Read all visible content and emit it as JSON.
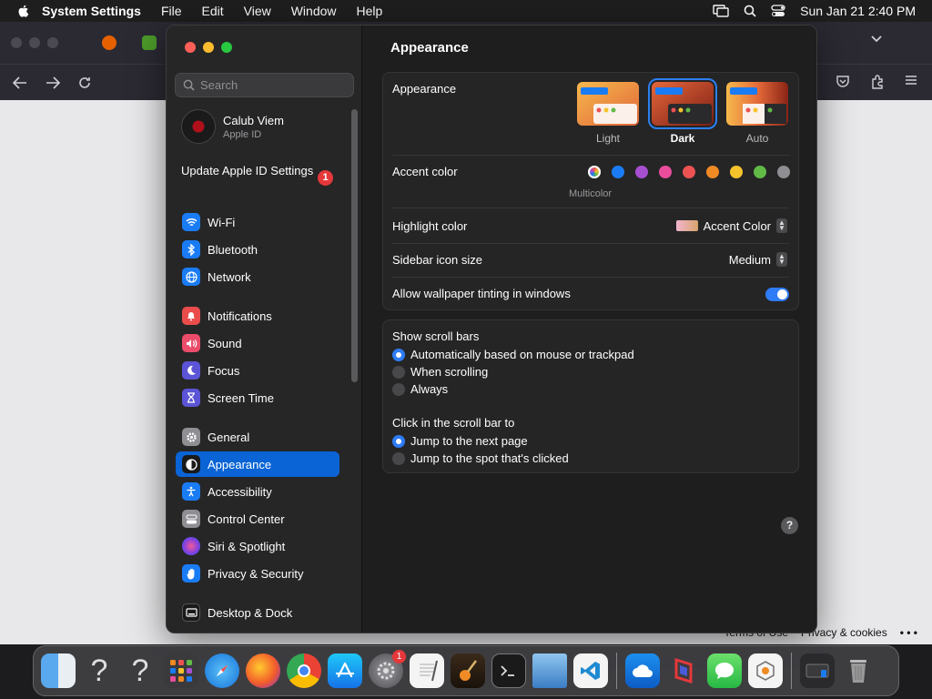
{
  "menubar": {
    "app_name": "System Settings",
    "items": [
      "File",
      "Edit",
      "View",
      "Window",
      "Help"
    ],
    "datetime": "Sun Jan 21  2:40 PM"
  },
  "browser": {
    "footer_left": "Terms of Use",
    "footer_right": "Privacy & cookies",
    "more": "• • •"
  },
  "sidebar": {
    "search_placeholder": "Search",
    "profile": {
      "name": "Calub Viem",
      "subtitle": "Apple ID"
    },
    "update": {
      "label": "Update Apple ID Settings",
      "badge": "1"
    },
    "items": [
      {
        "label": "Wi-Fi",
        "icon": "wifi-icon",
        "color": "#1a7cf5"
      },
      {
        "label": "Bluetooth",
        "icon": "bluetooth-icon",
        "color": "#1a7cf5"
      },
      {
        "label": "Network",
        "icon": "globe-icon",
        "color": "#1a7cf5"
      },
      {
        "label": "Notifications",
        "icon": "bell-icon",
        "color": "#ea4c4c"
      },
      {
        "label": "Sound",
        "icon": "speaker-icon",
        "color": "#ea4c6a"
      },
      {
        "label": "Focus",
        "icon": "moon-icon",
        "color": "#5b54d6"
      },
      {
        "label": "Screen Time",
        "icon": "hourglass-icon",
        "color": "#5b54d6"
      },
      {
        "label": "General",
        "icon": "gear-icon",
        "color": "#8e8e93"
      },
      {
        "label": "Appearance",
        "icon": "appearance-icon",
        "color": "#1a1a1a"
      },
      {
        "label": "Accessibility",
        "icon": "accessibility-icon",
        "color": "#1a7cf5"
      },
      {
        "label": "Control Center",
        "icon": "control-center-icon",
        "color": "#8e8e93"
      },
      {
        "label": "Siri & Spotlight",
        "icon": "siri-icon",
        "color": "#9b4ad6"
      },
      {
        "label": "Privacy & Security",
        "icon": "hand-icon",
        "color": "#1a7cf5"
      },
      {
        "label": "Desktop & Dock",
        "icon": "dock-icon",
        "color": "#1a1a1a"
      }
    ]
  },
  "content": {
    "title": "Appearance",
    "appearance": {
      "label": "Appearance",
      "options": [
        {
          "label": "Light",
          "selected": false
        },
        {
          "label": "Dark",
          "selected": true
        },
        {
          "label": "Auto",
          "selected": false
        }
      ]
    },
    "accent": {
      "label": "Accent color",
      "colors": [
        "multicolor",
        "#1a7cf5",
        "#a64fd0",
        "#ea4d9b",
        "#ec5252",
        "#f08a24",
        "#f5c32c",
        "#62ba46",
        "#8e8e93"
      ],
      "selected_label": "Multicolor"
    },
    "highlight": {
      "label": "Highlight color",
      "value": "Accent Color"
    },
    "sidebar_icon_size": {
      "label": "Sidebar icon size",
      "value": "Medium"
    },
    "wallpaper_tinting": {
      "label": "Allow wallpaper tinting in windows",
      "on": true
    },
    "scroll_bars": {
      "label": "Show scroll bars",
      "options": [
        {
          "label": "Automatically based on mouse or trackpad",
          "selected": true
        },
        {
          "label": "When scrolling",
          "selected": false
        },
        {
          "label": "Always",
          "selected": false
        }
      ]
    },
    "click_scroll": {
      "label": "Click in the scroll bar to",
      "options": [
        {
          "label": "Jump to the next page",
          "selected": true
        },
        {
          "label": "Jump to the spot that's clicked",
          "selected": false
        }
      ]
    },
    "help": "?"
  },
  "dock": {
    "settings_badge": "1",
    "apps": [
      "Finder",
      "Unknown",
      "Unknown",
      "Launchpad",
      "Safari",
      "Firefox",
      "Chrome",
      "App Store",
      "System Settings",
      "TextEdit",
      "GarageBand",
      "Terminal",
      "Preview",
      "VS Code",
      "Cloud",
      "Outline",
      "Messages",
      "Git",
      "Trash"
    ]
  }
}
